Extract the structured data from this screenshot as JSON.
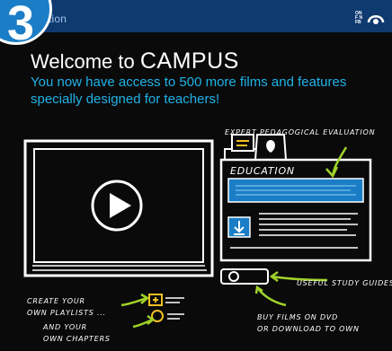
{
  "header": {
    "section_label": "ucation",
    "logo_text": "ONF NFB"
  },
  "step_badge": {
    "number": "3"
  },
  "headline": {
    "welcome": "Welcome to ",
    "brand": "CAMPUS"
  },
  "subtitle": "You now have access to 500 more films and features specially designed for teachers!",
  "annotations": {
    "pedagogical": "EXPERT PEDAGOGICAL EVALUATION",
    "study_guides": "USEFUL STUDY GUIDES",
    "playlists_1": "CREATE YOUR",
    "playlists_2": "OWN PLAYLISTS ...",
    "chapters_1": "AND YOUR",
    "chapters_2": "OWN CHAPTERS",
    "buy_1": "BUY FILMS ON DVD",
    "buy_2": "OR DOWNLOAD TO OWN"
  },
  "panel": {
    "tab_label": "EDUCATION"
  },
  "colors": {
    "header": "#0e3a70",
    "accent": "#1fb3e8",
    "badge": "#1b7dc6",
    "arrow": "#9fd22a",
    "highlight": "#f0c020"
  }
}
